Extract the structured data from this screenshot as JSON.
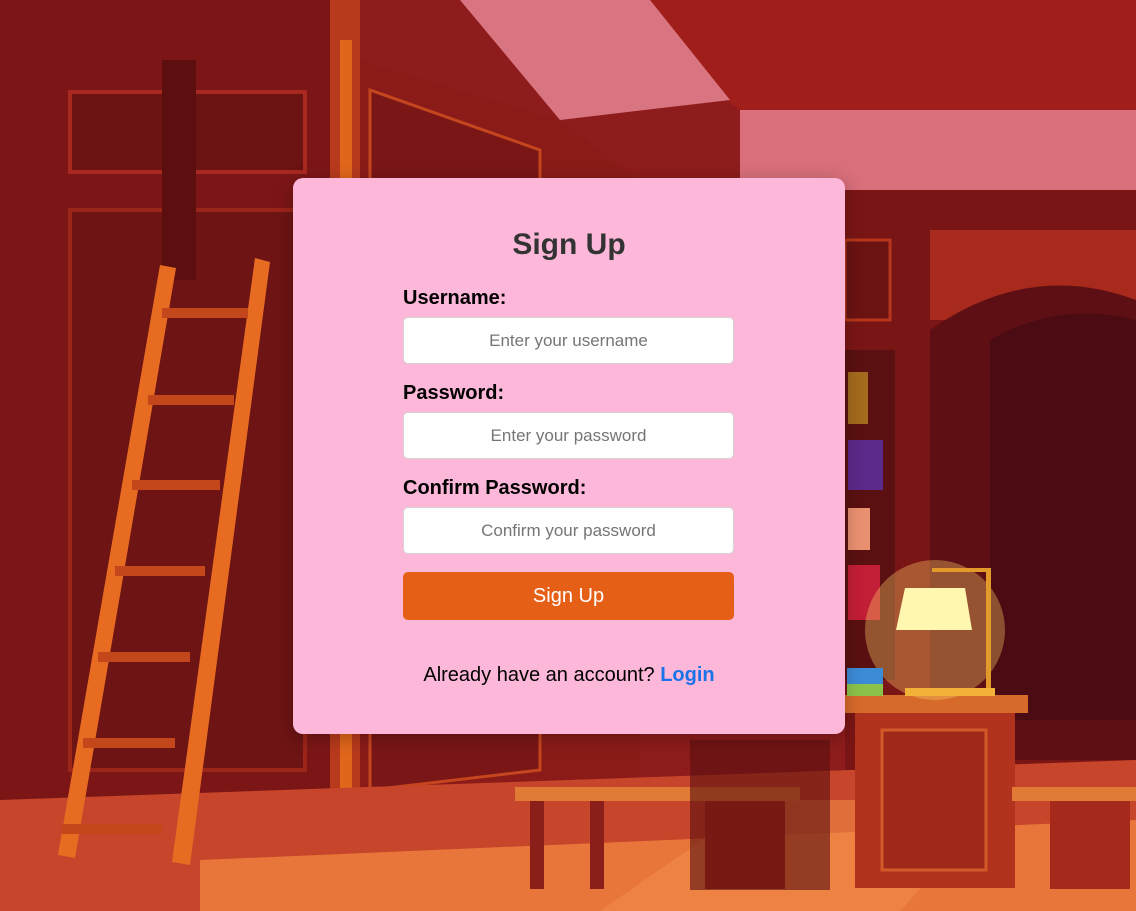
{
  "form": {
    "title": "Sign Up",
    "username": {
      "label": "Username:",
      "placeholder": "Enter your username",
      "value": ""
    },
    "password": {
      "label": "Password:",
      "placeholder": "Enter your password",
      "value": ""
    },
    "confirm_password": {
      "label": "Confirm Password:",
      "placeholder": "Confirm your password",
      "value": ""
    },
    "submit_label": "Sign Up",
    "footer_text": "Already have an account?",
    "login_link": "Login"
  },
  "colors": {
    "card_background": "#fdb7d8",
    "button": "#e65f17",
    "link": "#1a73e8",
    "scene_wall": "#8e1c1c"
  },
  "background": {
    "scene": "library-interior"
  }
}
